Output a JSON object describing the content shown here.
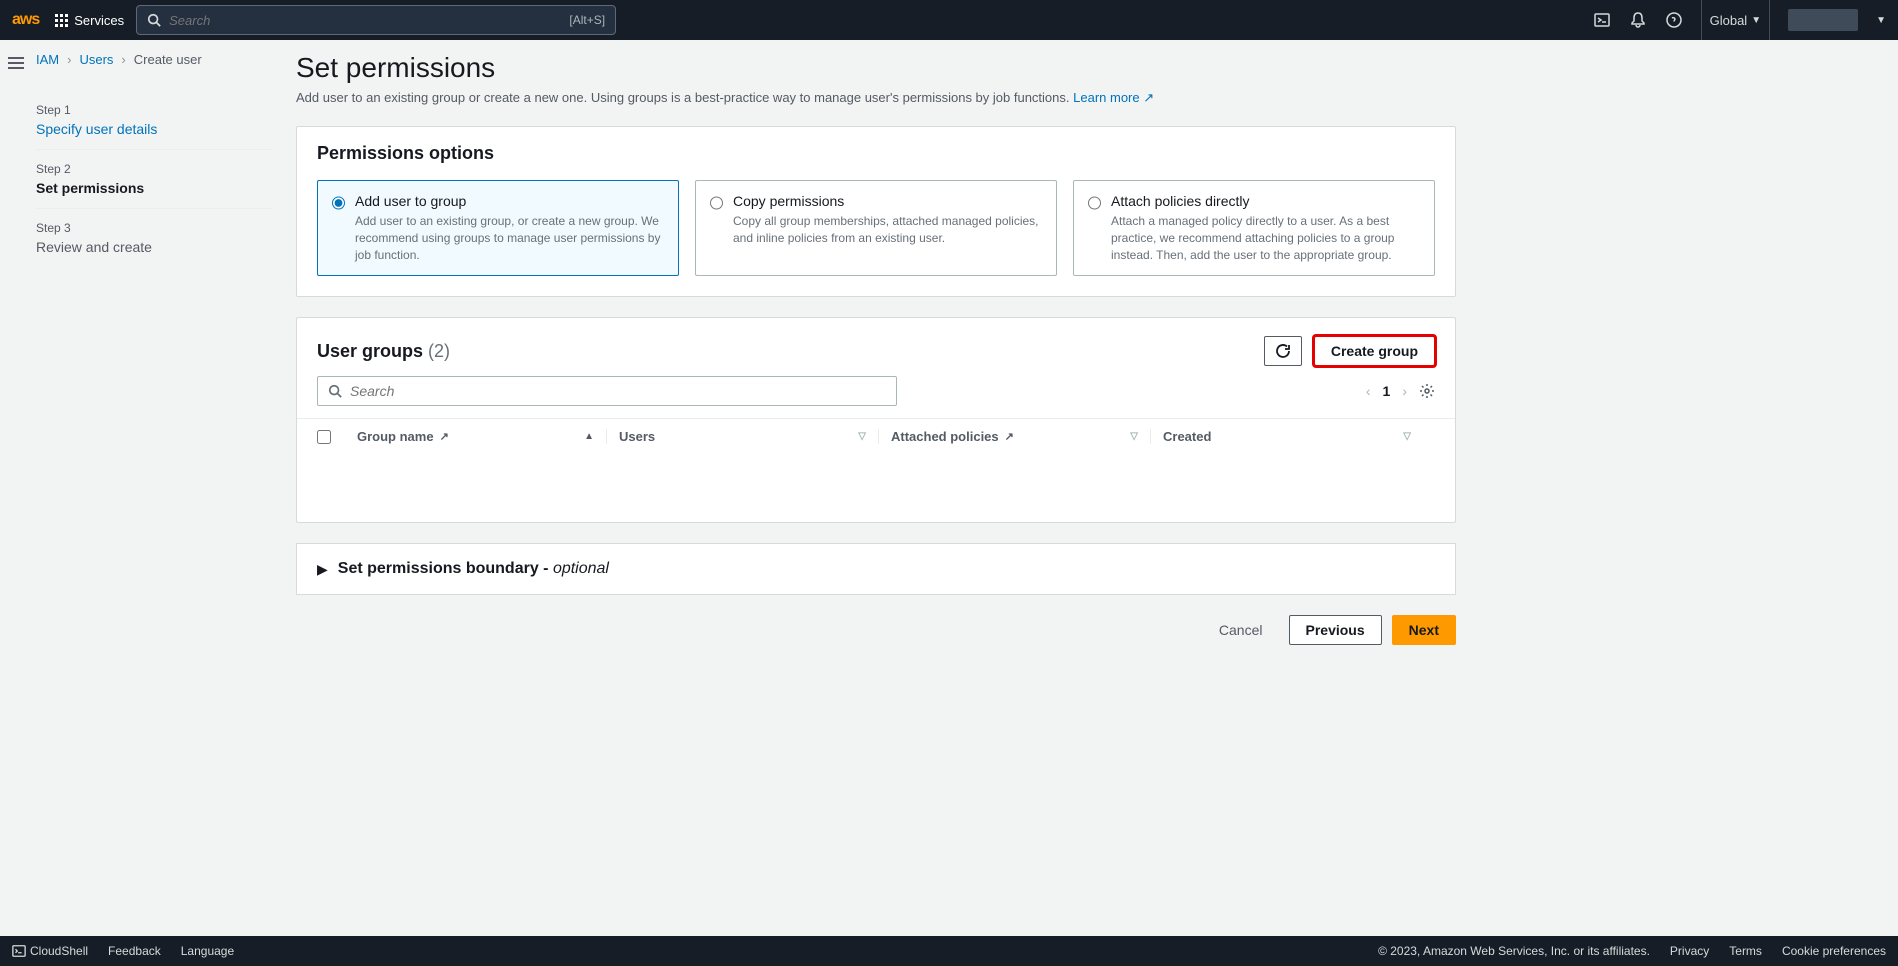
{
  "topnav": {
    "services": "Services",
    "search_placeholder": "Search",
    "shortcut": "[Alt+S]",
    "region": "Global"
  },
  "breadcrumb": {
    "iam": "IAM",
    "users": "Users",
    "current": "Create user"
  },
  "steps": [
    {
      "label": "Step 1",
      "title": "Specify user details",
      "state": "link"
    },
    {
      "label": "Step 2",
      "title": "Set permissions",
      "state": "active"
    },
    {
      "label": "Step 3",
      "title": "Review and create",
      "state": "future"
    }
  ],
  "page": {
    "title": "Set permissions",
    "description": "Add user to an existing group or create a new one. Using groups is a best-practice way to manage user's permissions by job functions.",
    "learn_more": "Learn more"
  },
  "permissions_panel": {
    "header": "Permissions options",
    "options": [
      {
        "title": "Add user to group",
        "desc": "Add user to an existing group, or create a new group. We recommend using groups to manage user permissions by job function.",
        "selected": true
      },
      {
        "title": "Copy permissions",
        "desc": "Copy all group memberships, attached managed policies, and inline policies from an existing user.",
        "selected": false
      },
      {
        "title": "Attach policies directly",
        "desc": "Attach a managed policy directly to a user. As a best practice, we recommend attaching policies to a group instead. Then, add the user to the appropriate group.",
        "selected": false
      }
    ]
  },
  "groups_panel": {
    "title": "User groups",
    "count": "(2)",
    "create_btn": "Create group",
    "search_placeholder": "Search",
    "page_number": "1",
    "columns": {
      "group": "Group name",
      "users": "Users",
      "policies": "Attached policies",
      "created": "Created"
    }
  },
  "boundary": {
    "title": "Set permissions boundary - ",
    "optional": "optional"
  },
  "actions": {
    "cancel": "Cancel",
    "previous": "Previous",
    "next": "Next"
  },
  "footer": {
    "cloudshell": "CloudShell",
    "feedback": "Feedback",
    "language": "Language",
    "copyright": "© 2023, Amazon Web Services, Inc. or its affiliates.",
    "privacy": "Privacy",
    "terms": "Terms",
    "cookies": "Cookie preferences"
  }
}
